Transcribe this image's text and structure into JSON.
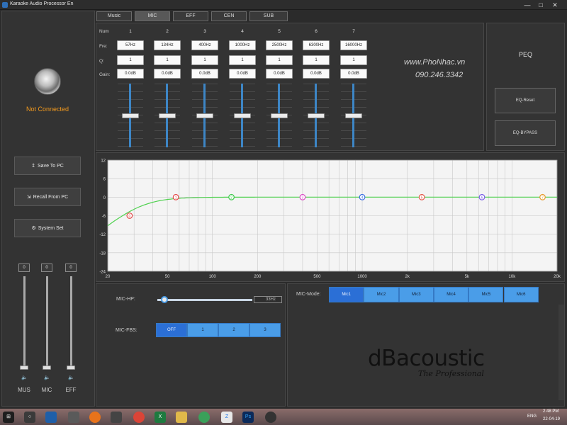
{
  "window": {
    "title": "Karaoke Audio Processor En",
    "minimize": "—",
    "maximize": "□",
    "close": "✕"
  },
  "tabs": [
    "Music",
    "MIC",
    "EFF",
    "CEN",
    "SUB"
  ],
  "selected_tab": "MIC",
  "left": {
    "status": "Not Connected",
    "buttons": [
      {
        "icon": "↥",
        "label": "Save To PC"
      },
      {
        "icon": "⇲",
        "label": "Recall From PC"
      },
      {
        "icon": "⚙",
        "label": "System Set"
      }
    ],
    "faders": [
      {
        "label": "MUS",
        "value": "0",
        "level": 0.0
      },
      {
        "label": "MIC",
        "value": "0",
        "level": 0.0
      },
      {
        "label": "EFF",
        "value": "0",
        "level": 0.0
      }
    ],
    "speaker_icon": "🔈"
  },
  "peq": {
    "row_labels": {
      "num": "Num",
      "fre": "Fre:",
      "q": "Q:",
      "gain": "Gain:"
    },
    "bands": [
      {
        "num": "1",
        "fre": "57Hz",
        "q": "1",
        "gain": "0.0dB"
      },
      {
        "num": "2",
        "fre": "134Hz",
        "q": "1",
        "gain": "0.0dB"
      },
      {
        "num": "3",
        "fre": "400Hz",
        "q": "1",
        "gain": "0.0dB"
      },
      {
        "num": "4",
        "fre": "1000Hz",
        "q": "1",
        "gain": "0.0dB"
      },
      {
        "num": "5",
        "fre": "2500Hz",
        "q": "1",
        "gain": "0.0dB"
      },
      {
        "num": "6",
        "fre": "6300Hz",
        "q": "1",
        "gain": "0.0dB"
      },
      {
        "num": "7",
        "fre": "16000Hz",
        "q": "1",
        "gain": "0.0dB"
      }
    ],
    "watermark_site": "www.PhoNhac.vn",
    "watermark_phone": "090.246.3342",
    "side_title": "PEQ",
    "reset_label": "EQ-Reset",
    "bypass_label": "EQ-BYPASS"
  },
  "graph": {
    "y_ticks": [
      "12",
      "6",
      "0",
      "-6",
      "-12",
      "-18",
      "-24"
    ],
    "x_ticks": [
      "20",
      "50",
      "100",
      "200",
      "500",
      "1000",
      "2k",
      "5k",
      "10k",
      "20k"
    ],
    "points": [
      {
        "label": "0",
        "freq": 28,
        "gain": -6,
        "color": "#e34b4b"
      },
      {
        "label": "1",
        "freq": 57,
        "gain": 0,
        "color": "#e34b4b"
      },
      {
        "label": "2",
        "freq": 134,
        "gain": 0,
        "color": "#3cc94a"
      },
      {
        "label": "3",
        "freq": 400,
        "gain": 0,
        "color": "#d94bc4"
      },
      {
        "label": "4",
        "freq": 1000,
        "gain": 0,
        "color": "#3b6fe0"
      },
      {
        "label": "5",
        "freq": 2500,
        "gain": 0,
        "color": "#e35a4b"
      },
      {
        "label": "6",
        "freq": 6300,
        "gain": 0,
        "color": "#7b5fe6"
      },
      {
        "label": "7",
        "freq": 16000,
        "gain": 0,
        "color": "#e69a2b"
      }
    ],
    "ylim": [
      -24,
      12
    ],
    "xlim": [
      20,
      20000
    ],
    "curve_color": "#4fd14f"
  },
  "mic": {
    "hp_label": "MIC-HP:",
    "hp_value": "33Hz",
    "fbs_label": "MIC-FBS:",
    "fbs_options": [
      "OFF",
      "1",
      "2",
      "3"
    ],
    "fbs_selected": "OFF",
    "mode_label": "MIC-Mode:",
    "mode_options": [
      "Mic1",
      "Mic2",
      "Mic3",
      "Mic4",
      "Mic5",
      "Mic6"
    ],
    "mode_selected": "Mic1"
  },
  "brand": {
    "logo": "dBacoustic",
    "slogan": "The Professional"
  },
  "taskbar": {
    "lang": "ENG",
    "time": "2:48 PM",
    "date": "22-04-19"
  }
}
